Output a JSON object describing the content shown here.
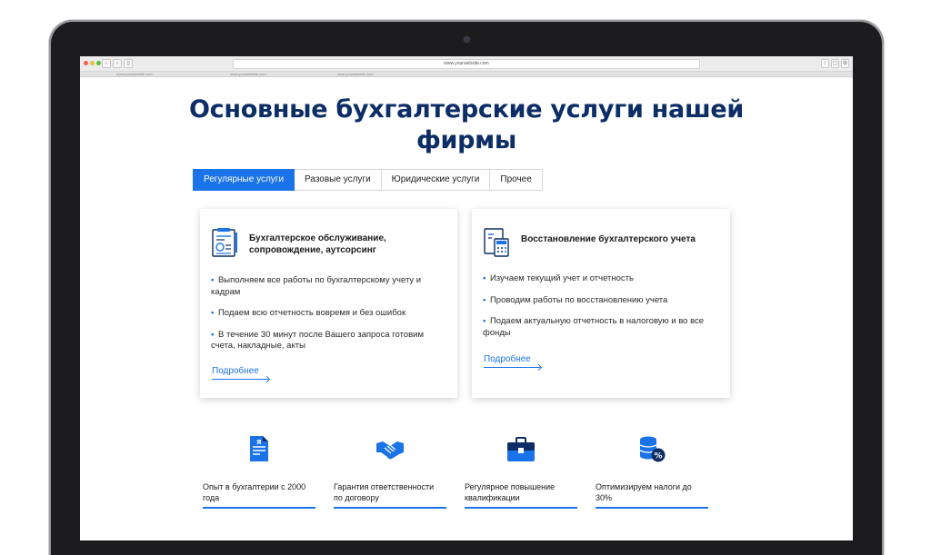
{
  "browser": {
    "url": "www.yourwebsite.com",
    "tabs": [
      "www.yourwebsite.com",
      "www.yourwebsite.com",
      "www.yourwebsite.com"
    ]
  },
  "page": {
    "title_line1": "Основные бухгалтерские услуги нашей",
    "title_line2": "фирмы"
  },
  "tabs": [
    {
      "label": "Регулярные услуги",
      "active": true
    },
    {
      "label": "Разовые услуги",
      "active": false
    },
    {
      "label": "Юридические услуги",
      "active": false
    },
    {
      "label": "Прочее",
      "active": false
    }
  ],
  "cards": [
    {
      "icon": "accounting-document-icon",
      "title_line1": "Бухгалтерское обслуживание,",
      "title_line2": "сопровождение, аутсорсинг",
      "items": [
        "Выполняем все работы по бухгалтерскому учету и кадрам",
        "Подаем всю отчетность вовремя и без ошибок",
        "В течение 30 минут после Вашего запроса готовим счета, накладные, акты"
      ],
      "more_label": "Подробнее"
    },
    {
      "icon": "calculator-document-icon",
      "title_line1": "Восстановление бухгалтерского учета",
      "items": [
        "Изучаем текущий учет и отчетность",
        "Проводим работы по восстановлению учета",
        "Подаем актуальную отчетность в налоговую и во все фонды"
      ],
      "more_label": "Подробнее"
    }
  ],
  "features": [
    {
      "icon": "certificate-document-icon",
      "line1": "Опыт в бухгалтерии с 2000",
      "line2": "года"
    },
    {
      "icon": "handshake-icon",
      "line1": "Гарантия ответственности",
      "line2": "по договору"
    },
    {
      "icon": "briefcase-icon",
      "line1": "Регулярное повышение",
      "line2": "квалификации"
    },
    {
      "icon": "coins-percent-icon",
      "line1": "Оптимизируем налоги до",
      "line2": "30%"
    }
  ],
  "colors": {
    "accent": "#1a73e8",
    "title": "#0c2d66"
  }
}
